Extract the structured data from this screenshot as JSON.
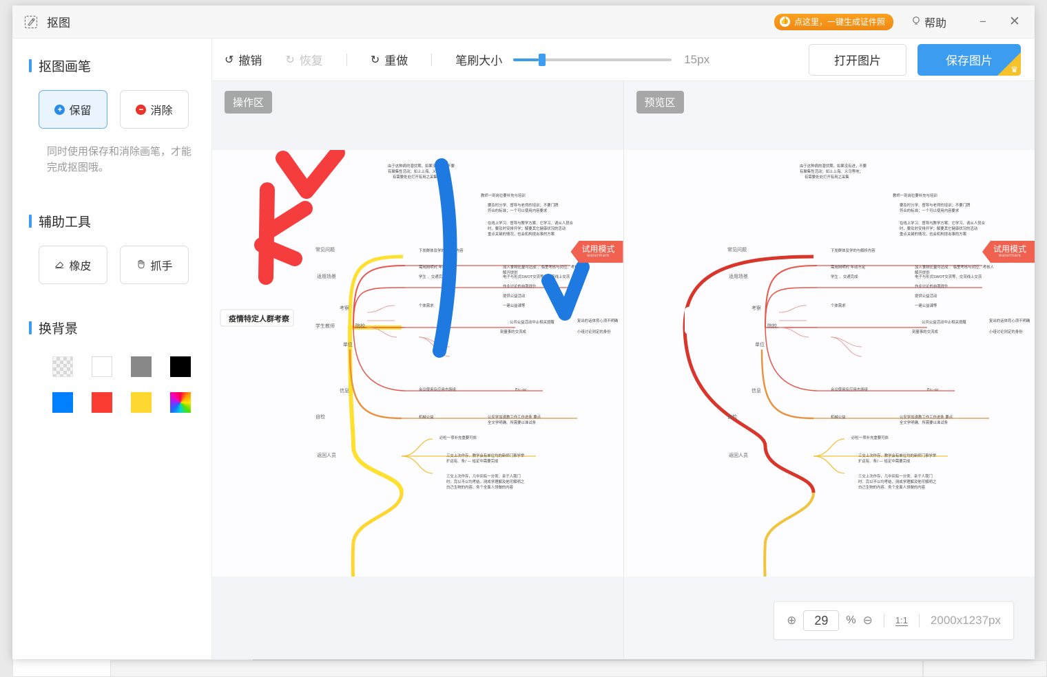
{
  "window": {
    "title": "抠图",
    "app_icon": "cutout-icon",
    "minimize_label": "−",
    "close_label": "✕",
    "help_label": "帮助",
    "help_icon": "lightbulb-icon",
    "promo_badge": {
      "text": "点这里，一键生成证件照",
      "icon": "thumbs-up-icon",
      "color": "#f29017"
    }
  },
  "sidebar": {
    "sections": [
      {
        "title": "抠图画笔"
      },
      {
        "title": "辅助工具"
      },
      {
        "title": "换背景"
      }
    ],
    "brush_buttons": [
      {
        "label": "保留",
        "icon": "plus-circle-icon",
        "active": true
      },
      {
        "label": "消除",
        "icon": "minus-circle-icon",
        "active": false
      }
    ],
    "hint": "同时使用保存和消除画笔，才能完成抠图哦。",
    "aux_buttons": [
      {
        "label": "橡皮",
        "icon": "eraser-icon"
      },
      {
        "label": "抓手",
        "icon": "hand-icon"
      }
    ],
    "background_swatches": [
      {
        "name": "transparent",
        "color": "transparent"
      },
      {
        "name": "white",
        "color": "#ffffff"
      },
      {
        "name": "gray",
        "color": "#888888"
      },
      {
        "name": "black",
        "color": "#000000"
      },
      {
        "name": "blue",
        "color": "#0080ff"
      },
      {
        "name": "red",
        "color": "#fa3c32"
      },
      {
        "name": "yellow",
        "color": "#ffd731"
      },
      {
        "name": "rainbow",
        "color": "rainbow"
      }
    ]
  },
  "toolbar": {
    "undo_label": "撤销",
    "undo_icon": "undo-arrow-icon",
    "redo_label": "恢复",
    "redo_icon": "redo-arrow-icon",
    "reset_label": "重做",
    "reset_icon": "refresh-icon",
    "brush_size_label": "笔刷大小",
    "brush_size_value": "15px",
    "brush_size_percent": 16,
    "open_label": "打开图片",
    "save_label": "保存图片",
    "save_badge_icon": "crown-icon"
  },
  "canvas": {
    "operation_label": "操作区",
    "preview_label": "预览区",
    "trial_ribbon": "试用模式",
    "trial_ribbon_sub": "watermark",
    "mindmap_root": "疫情特定人群考察"
  },
  "zoombar": {
    "zoom_in_icon": "zoom-in-icon",
    "zoom_out_icon": "zoom-out-icon",
    "zoom_value": "29",
    "percent_symbol": "%",
    "fit_label": "1:1",
    "dimensions": "2000x1237px"
  },
  "colors": {
    "accent": "#3c9cf0",
    "danger": "#e8332a",
    "promo": "#f29017",
    "ribbon": "#f1614f",
    "brush_red": "#f53d3d",
    "brush_blue": "#1e7ae0",
    "brush_yellow": "#ffe02e"
  }
}
